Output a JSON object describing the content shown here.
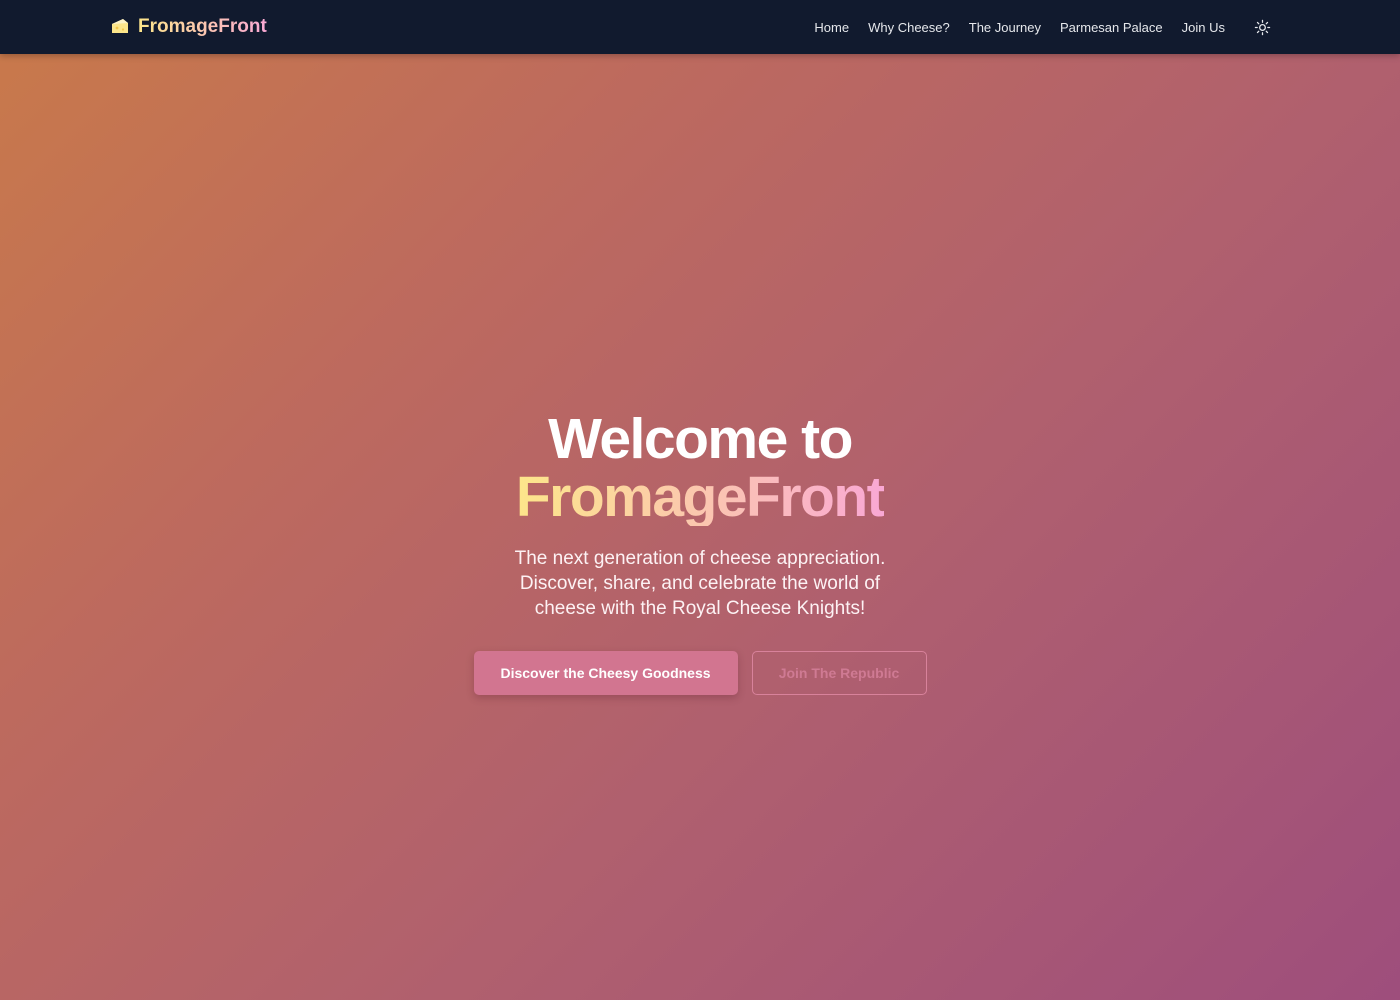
{
  "navbar": {
    "brand": {
      "icon": "cheese-icon",
      "name": "FromageFront"
    },
    "links": [
      {
        "label": "Home"
      },
      {
        "label": "Why Cheese?"
      },
      {
        "label": "The Journey"
      },
      {
        "label": "Parmesan Palace"
      },
      {
        "label": "Join Us"
      }
    ],
    "theme_toggle_icon": "sun-icon"
  },
  "hero": {
    "title_line1": "Welcome to",
    "title_line2": "FromageFront",
    "subtitle": "The next generation of cheese appreciation. Discover, share, and celebrate the world of cheese with the Royal Cheese Knights!",
    "primary_button": "Discover the Cheesy Goodness",
    "secondary_button": "Join The Republic"
  },
  "colors": {
    "navbar_bg": "#111a2e",
    "gradient_start": "#c97a4a",
    "gradient_end": "#9e4e7c",
    "brand_gradient_start": "#fde68a",
    "brand_gradient_end": "#f9a8d4",
    "primary_button_bg": "#d27590",
    "secondary_button_border": "#d8829b"
  }
}
